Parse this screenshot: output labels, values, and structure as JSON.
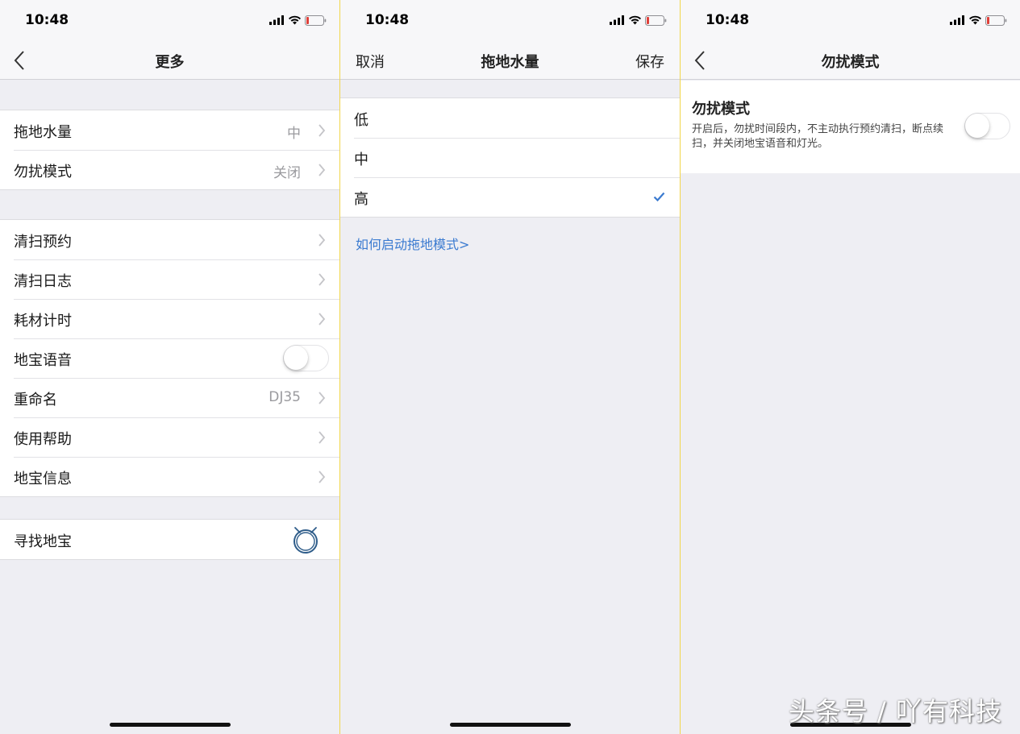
{
  "status": {
    "time": "10:48"
  },
  "screen1": {
    "title": "更多",
    "group1": [
      {
        "label": "拖地水量",
        "value": "中"
      },
      {
        "label": "勿扰模式",
        "value": "关闭"
      }
    ],
    "group2": [
      {
        "label": "清扫预约",
        "value": ""
      },
      {
        "label": "清扫日志",
        "value": ""
      },
      {
        "label": "耗材计时",
        "value": ""
      },
      {
        "label": "地宝语音",
        "toggle": "off"
      },
      {
        "label": "重命名",
        "value": "DJ35"
      },
      {
        "label": "使用帮助",
        "value": ""
      },
      {
        "label": "地宝信息",
        "value": ""
      }
    ],
    "group3": [
      {
        "label": "寻找地宝",
        "icon": "robot-icon"
      }
    ]
  },
  "screen2": {
    "title": "拖地水量",
    "cancel": "取消",
    "save": "保存",
    "options": [
      {
        "label": "低",
        "selected": false
      },
      {
        "label": "中",
        "selected": false
      },
      {
        "label": "高",
        "selected": true
      }
    ],
    "help_link": "如何启动拖地模式>",
    "accent": "#3a7ad0"
  },
  "screen3": {
    "title": "勿扰模式",
    "card_title": "勿扰模式",
    "card_desc": "开启后，勿扰时间段内，不主动执行预约清扫，断点续扫，并关闭地宝语音和灯光。",
    "toggle": "off"
  },
  "watermark": "头条号 / 吖有科技"
}
